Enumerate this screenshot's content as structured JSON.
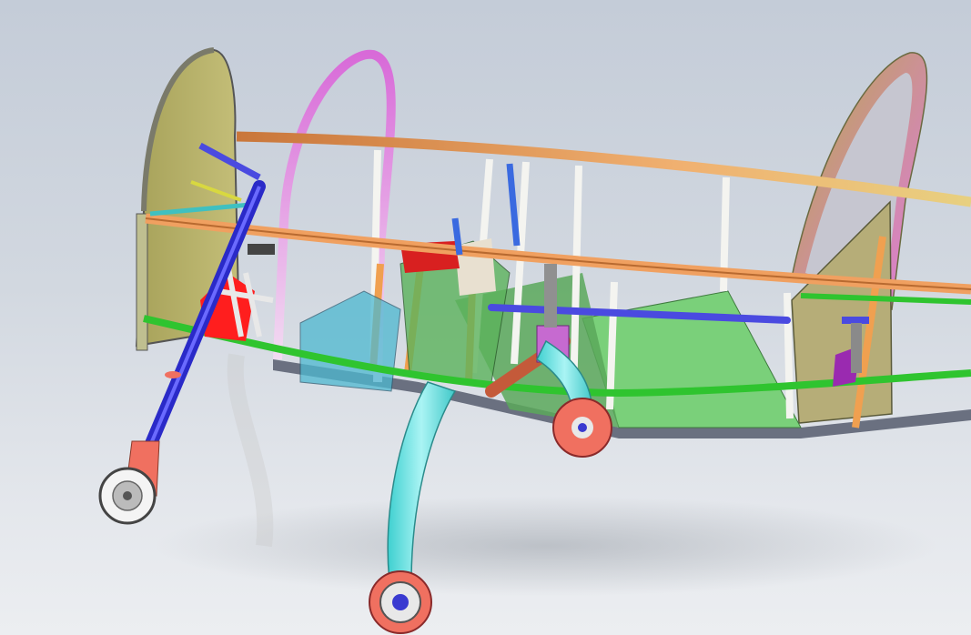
{
  "scene": {
    "background_top": "#c4ccd8",
    "background_bottom": "#eceef1",
    "parts": {
      "longerons": "#d9884a",
      "lower_longerons": "#33c433",
      "hoops": "#d680d6",
      "firewall": "#b8b36a",
      "nose_gear_strut": "#3a3ad0",
      "main_gear_leg": "#5ee3e3",
      "wheel_rim": "#f07060",
      "engine_mount": "#ff2020",
      "cross_shaft": "#4a4ae0",
      "bellcrank": "#c66ad0",
      "side_panel": "#8ad68a"
    }
  }
}
